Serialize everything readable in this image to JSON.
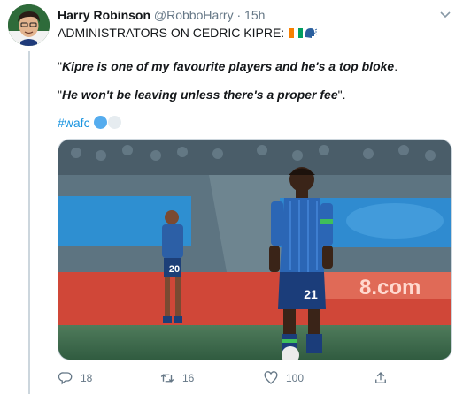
{
  "tweet": {
    "author_name": "Harry Robinson",
    "handle": "@RobboHarry",
    "separator": "·",
    "time": "15h",
    "headline": "ADMINISTRATORS ON CEDRIC KIPRE:",
    "quote1": "Kipre is one of my favourite players and he's a top bloke",
    "quote1_end": ".",
    "quote2": "He won't be leaving unless there's a proper fee",
    "quote2_end": ".",
    "open_quote": "\"",
    "close_quote": "\"",
    "hashtag": "#wafc",
    "icons": [
      "flag-ivory-coast-icon",
      "speaking-head-icon",
      "blue-circle-icon",
      "white-circle-icon"
    ]
  },
  "actions": {
    "reply_count": "18",
    "retweet_count": "16",
    "like_count": "100"
  },
  "media": {
    "jersey_number_front": "21",
    "jersey_number_back": "20",
    "stadium_text": "8.com"
  },
  "colors": {
    "link": "#1b95e0",
    "secondary_text": "#657786",
    "border": "#ccd6dd",
    "flag_orange": "#f77f00",
    "flag_white": "#ffffff",
    "flag_green": "#009e60"
  }
}
